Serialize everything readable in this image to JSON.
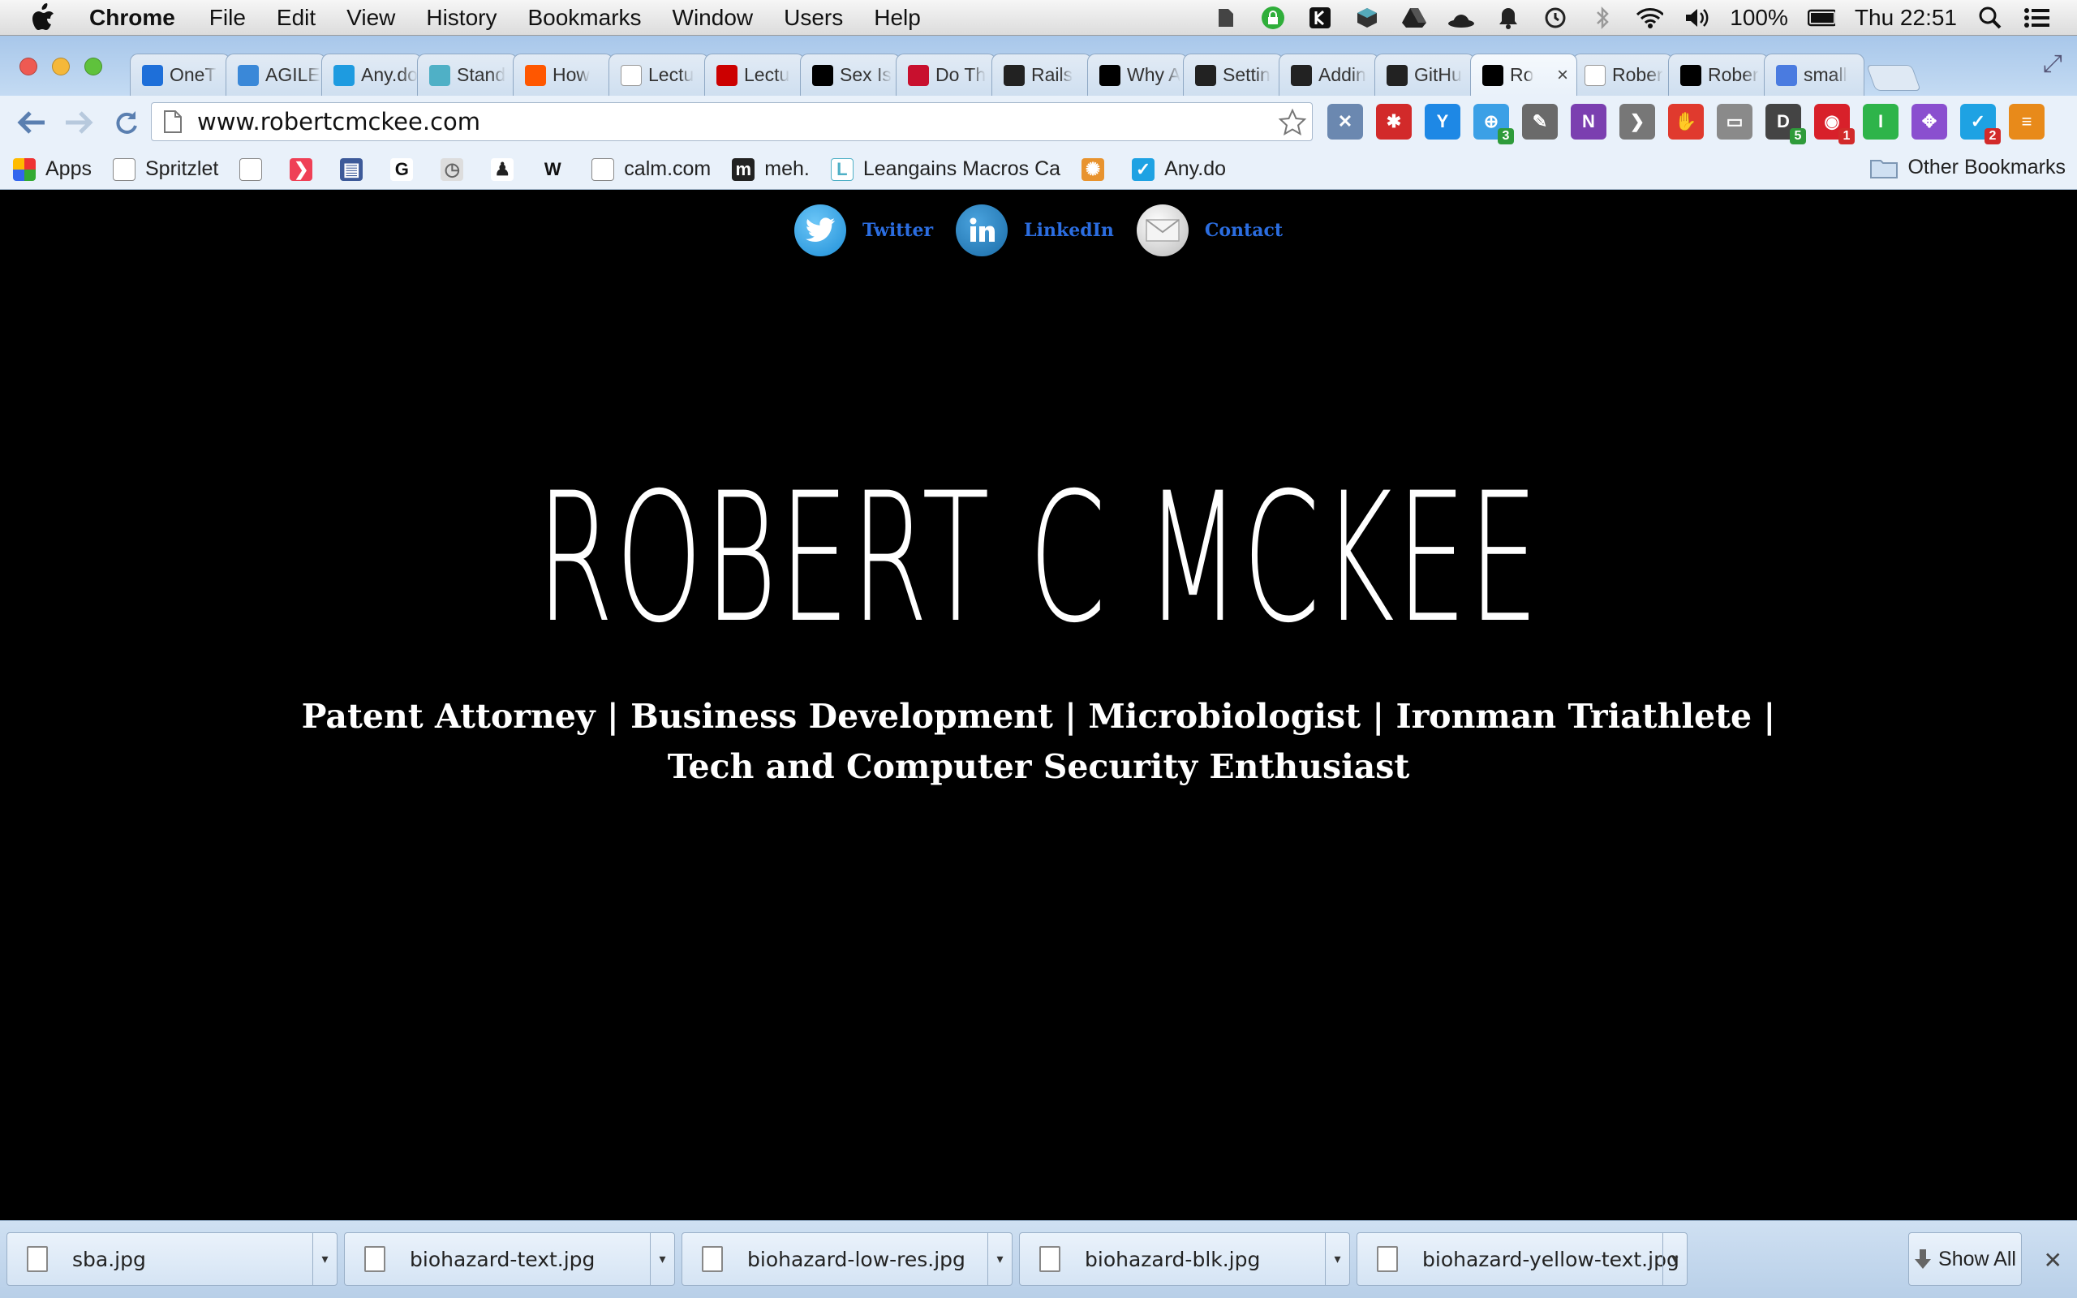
{
  "menubar": {
    "app_name": "Chrome",
    "menus": [
      "File",
      "Edit",
      "View",
      "History",
      "Bookmarks",
      "Window",
      "Users",
      "Help"
    ],
    "battery": "100%",
    "clock": "Thu 22:51"
  },
  "tabs": [
    {
      "label": "OneT",
      "icon": "onetab-icon",
      "color": "#1e6fd9"
    },
    {
      "label": "AGILE",
      "icon": "agile-icon",
      "color": "#3a88d8"
    },
    {
      "label": "Any.do",
      "icon": "anydo-icon",
      "color": "#1e9be0"
    },
    {
      "label": "Stand",
      "icon": "lgmc-icon",
      "color": "#4fb0c6"
    },
    {
      "label": "How",
      "icon": "reddit-icon",
      "color": "#ff5700"
    },
    {
      "label": "Lectu",
      "icon": "page-icon",
      "color": "#ffffff"
    },
    {
      "label": "Lectu",
      "icon": "youtube-icon",
      "color": "#cc0000"
    },
    {
      "label": "Sex Is",
      "icon": "medium-icon",
      "color": "#000000"
    },
    {
      "label": "Do Th",
      "icon": "dothings-icon",
      "color": "#c8102e"
    },
    {
      "label": "Rails",
      "icon": "graduation-cap-icon",
      "color": "#222222"
    },
    {
      "label": "Why A",
      "icon": "nytimes-icon",
      "color": "#000000"
    },
    {
      "label": "Settin",
      "icon": "github-icon",
      "color": "#222222"
    },
    {
      "label": "Addin",
      "icon": "github-icon",
      "color": "#222222"
    },
    {
      "label": "GitHu",
      "icon": "github-icon",
      "color": "#222222"
    },
    {
      "label": "Ro",
      "icon": "rcm-icon",
      "color": "#000000",
      "active": true
    },
    {
      "label": "Rober",
      "icon": "page-icon",
      "color": "#ffffff"
    },
    {
      "label": "Rober",
      "icon": "rcm-icon",
      "color": "#000000"
    },
    {
      "label": "small",
      "icon": "google-icon",
      "color": "#4a7be0"
    }
  ],
  "omnibox": {
    "url": "www.robertcmckee.com"
  },
  "extensions": [
    {
      "name": "expand-icon",
      "color": "#6b88b0",
      "glyph": "✕",
      "badge": ""
    },
    {
      "name": "lastpass-icon",
      "color": "#d22a2a",
      "glyph": "✱",
      "badge": ""
    },
    {
      "name": "onetab-ext-icon",
      "color": "#1e88e5",
      "glyph": "Y",
      "badge": ""
    },
    {
      "name": "globe-icon",
      "color": "#3ba0e6",
      "glyph": "⊕",
      "badge": "3"
    },
    {
      "name": "evernote-icon",
      "color": "#6a6a6a",
      "glyph": "✎",
      "badge": ""
    },
    {
      "name": "onenote-icon",
      "color": "#7b3fb0",
      "glyph": "N",
      "badge": ""
    },
    {
      "name": "pocket-icon",
      "color": "#777777",
      "glyph": "❯",
      "badge": ""
    },
    {
      "name": "adblock-icon",
      "color": "#e03a2e",
      "glyph": "✋",
      "badge": ""
    },
    {
      "name": "cast-icon",
      "color": "#8a8a8a",
      "glyph": "▭",
      "badge": ""
    },
    {
      "name": "dashlane-icon",
      "color": "#444444",
      "glyph": "D",
      "badge": "5"
    },
    {
      "name": "lips-icon",
      "color": "#d8202a",
      "glyph": "◉",
      "badge": "1"
    },
    {
      "name": "instapaper-icon",
      "color": "#2eb44a",
      "glyph": "I",
      "badge": ""
    },
    {
      "name": "move-icon",
      "color": "#8a4fcf",
      "glyph": "✥",
      "badge": ""
    },
    {
      "name": "anydo-ext-icon",
      "color": "#1ea2e3",
      "glyph": "✓",
      "badge": "2"
    },
    {
      "name": "menu-icon",
      "color": "#e88a1a",
      "glyph": "≡",
      "badge": ""
    }
  ],
  "bookmarks": {
    "items": [
      {
        "label": "Apps",
        "icon": "apps-grid-icon"
      },
      {
        "label": "Spritzlet",
        "icon": "page-icon"
      },
      {
        "label": "",
        "icon": "page-icon"
      },
      {
        "label": "",
        "icon": "pocket-icon"
      },
      {
        "label": "",
        "icon": "clapper-icon"
      },
      {
        "label": "",
        "icon": "g-letter-icon"
      },
      {
        "label": "",
        "icon": "clock-icon"
      },
      {
        "label": "",
        "icon": "person-icon"
      },
      {
        "label": "",
        "icon": "w-letter-icon"
      },
      {
        "label": "calm.com",
        "icon": "page-icon"
      },
      {
        "label": "meh.",
        "icon": "meh-icon"
      },
      {
        "label": "Leangains Macros Ca",
        "icon": "lgmc-icon"
      },
      {
        "label": "",
        "icon": "brain-icon"
      },
      {
        "label": "Any.do",
        "icon": "anydo-icon"
      }
    ],
    "other": "Other Bookmarks"
  },
  "page": {
    "social": [
      {
        "label": "Twitter",
        "icon": "twitter-icon",
        "color": "#33aaf0"
      },
      {
        "label": "LinkedIn",
        "icon": "linkedin-icon",
        "color": "#2a87c8"
      },
      {
        "label": "Contact",
        "icon": "envelope-icon",
        "color": "#d9d9d9"
      }
    ],
    "title": "ROBERT C MCKEE",
    "tagline": "Patent Attorney | Business Development | Microbiologist | Ironman Triathlete | Tech and Computer Security Enthusiast"
  },
  "downloads": {
    "files": [
      "sba.jpg",
      "biohazard-text.jpg",
      "biohazard-low-res.jpg",
      "biohazard-blk.jpg",
      "biohazard-yellow-text.jpg"
    ],
    "show_all": "Show All"
  }
}
